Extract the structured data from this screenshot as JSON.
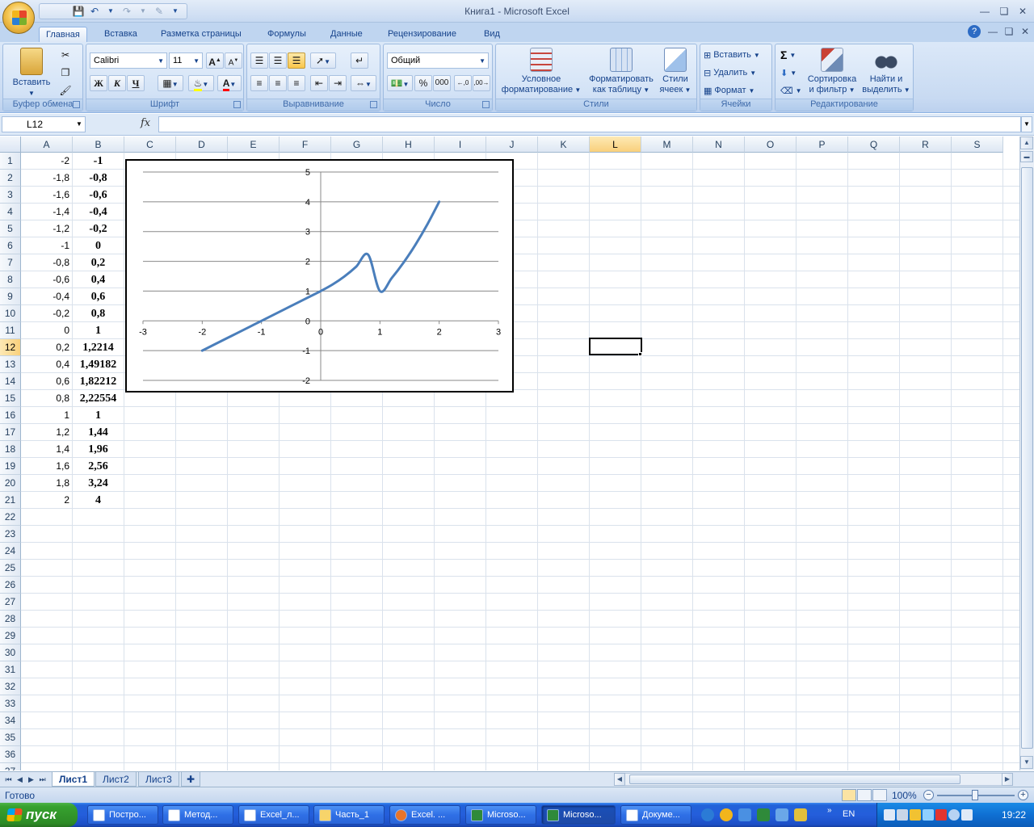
{
  "window": {
    "title": "Книга1 - Microsoft Excel"
  },
  "ribbon_tabs": [
    {
      "label": "Главная",
      "active": true
    },
    {
      "label": "Вставка"
    },
    {
      "label": "Разметка страницы"
    },
    {
      "label": "Формулы"
    },
    {
      "label": "Данные"
    },
    {
      "label": "Рецензирование"
    },
    {
      "label": "Вид"
    }
  ],
  "ribbon": {
    "clipboard": {
      "paste_label": "Вставить",
      "group_label": "Буфер обмена"
    },
    "font": {
      "font_name": "Calibri",
      "font_size": "11",
      "bold": "Ж",
      "italic": "К",
      "underline": "Ч",
      "group_label": "Шрифт"
    },
    "alignment": {
      "group_label": "Выравнивание"
    },
    "number": {
      "format": "Общий",
      "percent": "%",
      "thousands": "000",
      "group_label": "Число"
    },
    "styles": {
      "conditional_line1": "Условное",
      "conditional_line2": "форматирование",
      "table_line1": "Форматировать",
      "table_line2": "как таблицу",
      "cellstyles_line1": "Стили",
      "cellstyles_line2": "ячеек",
      "group_label": "Стили"
    },
    "cells": {
      "insert": "Вставить",
      "delete": "Удалить",
      "format": "Формат",
      "group_label": "Ячейки"
    },
    "editing": {
      "sum_symbol": "Σ",
      "sort_line1": "Сортировка",
      "sort_line2": "и фильтр",
      "find_line1": "Найти и",
      "find_line2": "выделить",
      "group_label": "Редактирование"
    }
  },
  "formula_bar": {
    "name_box": "L12",
    "fx": "fx",
    "formula": ""
  },
  "columns": [
    "A",
    "B",
    "C",
    "D",
    "E",
    "F",
    "G",
    "H",
    "I",
    "J",
    "K",
    "L",
    "M",
    "N",
    "O",
    "P",
    "Q",
    "R",
    "S"
  ],
  "selected_column": "L",
  "selected_row": 12,
  "row_numbers": [
    "1",
    "2",
    "3",
    "4",
    "5",
    "6",
    "7",
    "8",
    "9",
    "10",
    "11",
    "12",
    "13",
    "14",
    "15",
    "16",
    "17",
    "18",
    "19",
    "20",
    "21",
    "22",
    "23",
    "24",
    "25",
    "26",
    "27",
    "28",
    "29",
    "30",
    "31",
    "32",
    "33",
    "34",
    "35",
    "36",
    "37"
  ],
  "col_a": [
    "-2",
    "-1,8",
    "-1,6",
    "-1,4",
    "-1,2",
    "-1",
    "-0,8",
    "-0,6",
    "-0,4",
    "-0,2",
    "0",
    "0,2",
    "0,4",
    "0,6",
    "0,8",
    "1",
    "1,2",
    "1,4",
    "1,6",
    "1,8",
    "2"
  ],
  "col_b": [
    "-1",
    "-0,8",
    "-0,6",
    "-0,4",
    "-0,2",
    "0",
    "0,2",
    "0,4",
    "0,6",
    "0,8",
    "1",
    "1,2214",
    "1,49182",
    "1,82212",
    "2,22554",
    "1",
    "1,44",
    "1,96",
    "2,56",
    "3,24",
    "4"
  ],
  "chart_data": {
    "type": "scatter",
    "line": "smooth",
    "title": "",
    "xlabel": "",
    "ylabel": "",
    "xlim": [
      -3,
      3
    ],
    "ylim": [
      -2,
      5
    ],
    "x_ticks": [
      "-3",
      "-2",
      "-1",
      "0",
      "1",
      "2",
      "3"
    ],
    "y_ticks": [
      "-2",
      "-1",
      "0",
      "1",
      "2",
      "3",
      "4",
      "5"
    ],
    "grid": "horizontal",
    "series_color": "#4a7ebb",
    "series": [
      {
        "x": [
          -2,
          -1.8,
          -1.6,
          -1.4,
          -1.2,
          -1,
          -0.8,
          -0.6,
          -0.4,
          -0.2,
          0,
          0.2,
          0.4,
          0.6,
          0.8,
          1,
          1.2,
          1.4,
          1.6,
          1.8,
          2
        ],
        "y": [
          -1,
          -0.8,
          -0.6,
          -0.4,
          -0.2,
          0,
          0.2,
          0.4,
          0.6,
          0.8,
          1,
          1.2214,
          1.49182,
          1.82212,
          2.22554,
          1,
          1.44,
          1.96,
          2.56,
          3.24,
          4
        ]
      }
    ]
  },
  "sheets": [
    {
      "label": "Лист1",
      "active": true
    },
    {
      "label": "Лист2"
    },
    {
      "label": "Лист3"
    }
  ],
  "status": {
    "text": "Готово",
    "zoom": "100%"
  },
  "taskbar": {
    "start": "пуск",
    "tasks": [
      {
        "label": "Постро..."
      },
      {
        "label": "Метод..."
      },
      {
        "label": "Excel_л..."
      },
      {
        "label": "Часть_1"
      },
      {
        "label": "Excel. ..."
      },
      {
        "label": "Microso..."
      },
      {
        "label": "Microso...",
        "active": true
      },
      {
        "label": "Докуме..."
      }
    ],
    "language": "EN",
    "clock": "19:22"
  }
}
